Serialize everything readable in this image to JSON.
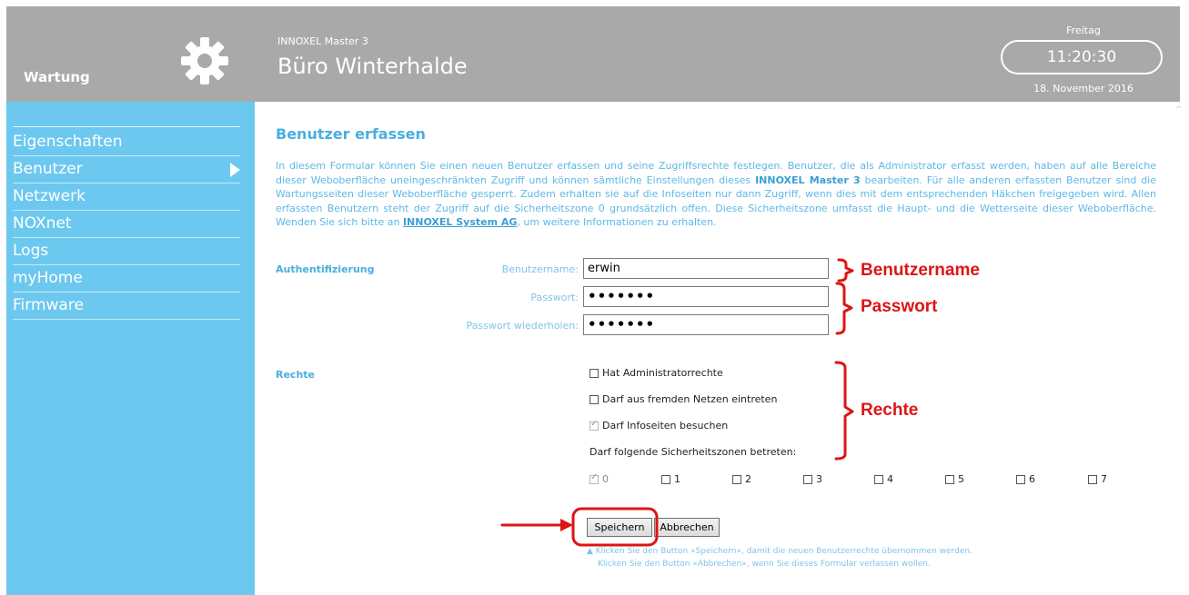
{
  "header": {
    "section_title": "Wartung",
    "product": "INNOXEL Master 3",
    "site_name": "Büro Winterhalde",
    "weekday": "Freitag",
    "time": "11:20:30",
    "date": "18. November 2016"
  },
  "sidebar": {
    "items": [
      {
        "label": "Eigenschaften"
      },
      {
        "label": "Benutzer"
      },
      {
        "label": "Netzwerk"
      },
      {
        "label": "NOXnet"
      },
      {
        "label": "Logs"
      },
      {
        "label": "myHome"
      },
      {
        "label": "Firmware"
      }
    ],
    "active_index": 1
  },
  "main": {
    "title": "Benutzer erfassen",
    "intro_1": "In diesem Formular können Sie einen neuen Benutzer erfassen und seine Zugriffsrechte festlegen. Benutzer, die als Administrator erfasst werden, haben auf alle Bereiche dieser Weboberfläche uneingeschränkten Zugriff und können sämtliche Einstellungen dieses ",
    "intro_bold": "INNOXEL Master 3",
    "intro_2": " bearbeiten. Für alle anderen erfassten Benutzer sind die Wartungsseiten dieser Weboberfläche gesperrt. Zudem erhalten sie auf die Infoseiten nur dann Zugriff, wenn dies mit dem entsprechenden Häkchen freigegeben wird. Allen erfassten Benutzern steht der Zugriff auf die Sicherheitszone 0 grundsätzlich offen. Diese Sicherheitszone umfasst die Haupt- und die Wetterseite dieser Weboberfläche. Wenden Sie sich bitte an ",
    "intro_link": "INNOXEL System AG",
    "intro_3": ", um weitere Informationen zu erhalten."
  },
  "auth": {
    "section_label": "Authentifizierung",
    "username_label": "Benutzername:",
    "username_value": "erwin",
    "password_label": "Passwort:",
    "password_value": "•••••••",
    "password_repeat_label": "Passwort wiederholen:",
    "password_repeat_value": "•••••••"
  },
  "rights": {
    "section_label": "Rechte",
    "options": [
      {
        "label": "Hat Administratorrechte",
        "checked": false
      },
      {
        "label": "Darf aus fremden Netzen eintreten",
        "checked": false
      },
      {
        "label": "Darf Infoseiten besuchen",
        "checked": true
      }
    ],
    "zones_label": "Darf folgende Sicherheitszonen betreten:",
    "zones": [
      {
        "label": "0",
        "checked": true
      },
      {
        "label": "1",
        "checked": false
      },
      {
        "label": "2",
        "checked": false
      },
      {
        "label": "3",
        "checked": false
      },
      {
        "label": "4",
        "checked": false
      },
      {
        "label": "5",
        "checked": false
      },
      {
        "label": "6",
        "checked": false
      },
      {
        "label": "7",
        "checked": false
      }
    ]
  },
  "buttons": {
    "save": "Speichern",
    "cancel": "Abbrechen"
  },
  "hints": {
    "line1": "▲ Klicken Sie den Button «Speichern», damit die neuen Benutzerrechte übernommen werden.",
    "line2": "Klicken Sie den Button «Abbrechen», wenn Sie dieses Formular verlassen wollen."
  },
  "annotations": {
    "username": "Benutzername",
    "password": "Passwort",
    "rights": "Rechte",
    "color": "#dd1515"
  }
}
